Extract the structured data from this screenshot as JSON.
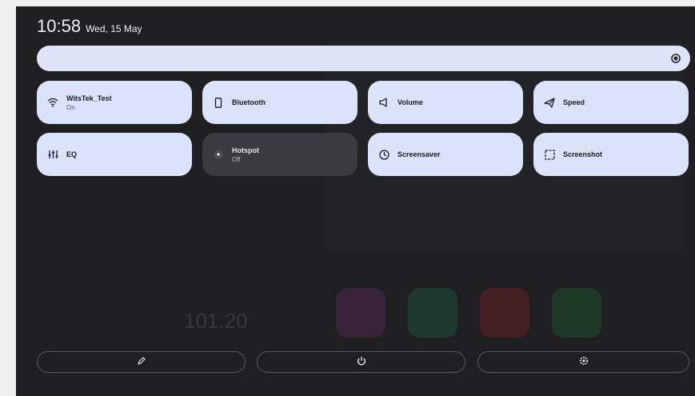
{
  "status": {
    "time": "10:58",
    "date": "Wed, 15 May"
  },
  "brightness": {
    "level": 1.0,
    "icon": "brightness-icon"
  },
  "tiles": [
    {
      "label": "WitsTek_Test",
      "sub": "On",
      "icon": "wifi-icon",
      "state": "on"
    },
    {
      "label": "Bluetooth",
      "icon": "bluetooth-icon",
      "state": "on"
    },
    {
      "label": "Volume",
      "icon": "volume-icon",
      "state": "on"
    },
    {
      "label": "Speed",
      "icon": "speed-icon",
      "state": "on"
    },
    {
      "label": "EQ",
      "icon": "equalizer-icon",
      "state": "on"
    },
    {
      "label": "Hotspot",
      "sub": "Off",
      "icon": "hotspot-icon",
      "state": "off"
    },
    {
      "label": "Screensaver",
      "icon": "clock-icon",
      "state": "on"
    },
    {
      "label": "Screenshot",
      "icon": "screenshot-icon",
      "state": "on"
    }
  ],
  "footer": {
    "edit_icon": "pencil-icon",
    "power_icon": "power-icon",
    "settings_icon": "gear-icon"
  },
  "background": {
    "radio_frequency": "101.20"
  },
  "colors": {
    "tile_on": "#dbe3fb",
    "tile_off": "#3a3b40",
    "panel": "#1f1f22"
  }
}
